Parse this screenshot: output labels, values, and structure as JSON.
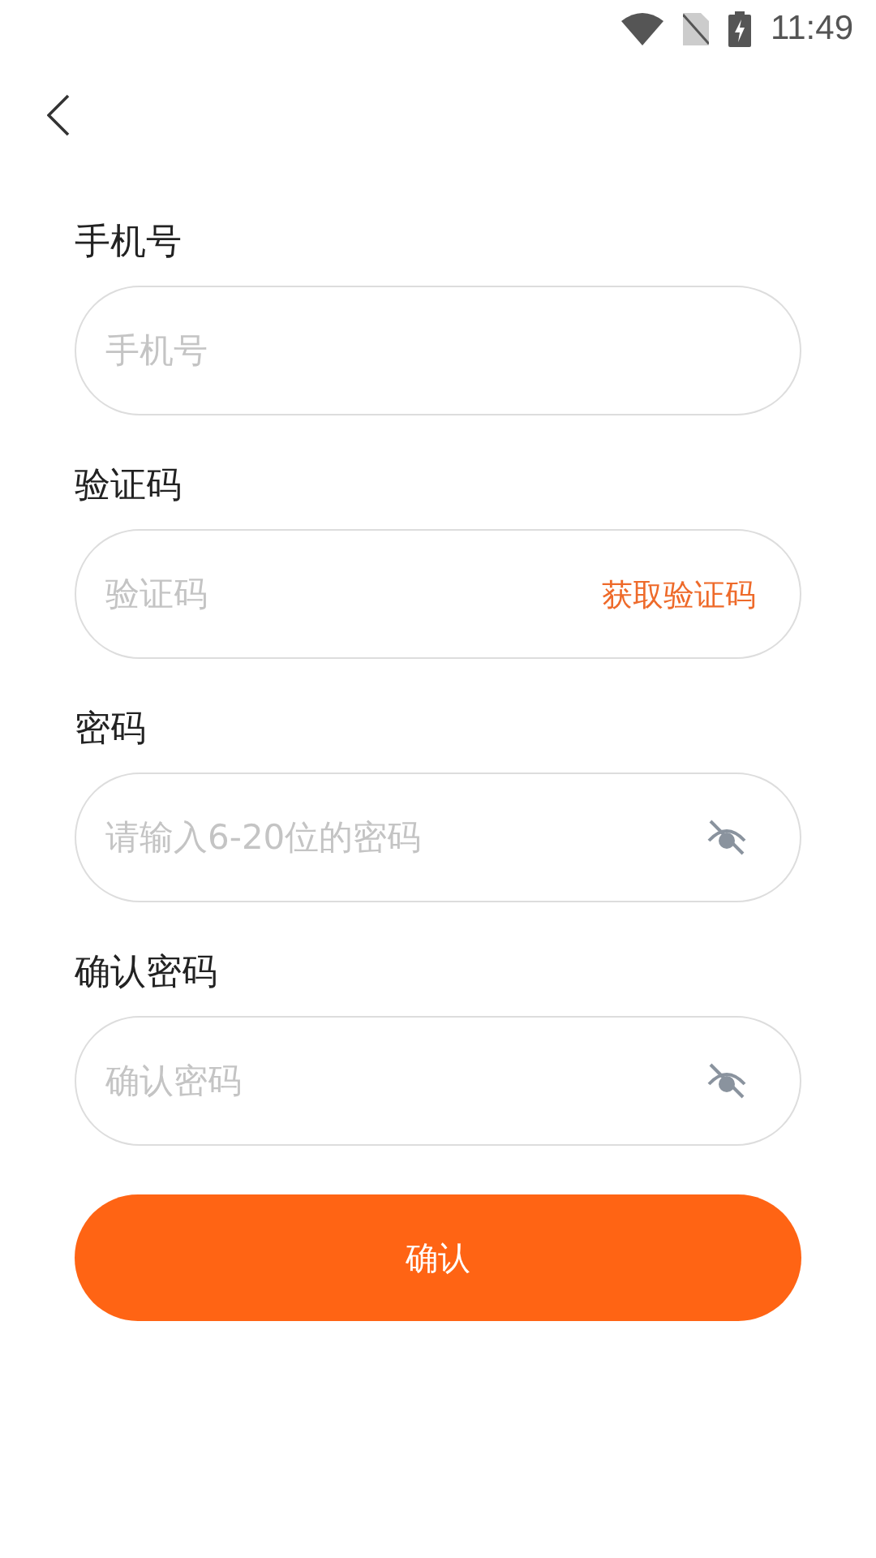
{
  "status_bar": {
    "time": "11:49"
  },
  "fields": [
    {
      "kind": "text",
      "label": "手机号",
      "placeholder": "手机号"
    },
    {
      "kind": "code",
      "label": "验证码",
      "placeholder": "验证码",
      "action": "获取验证码"
    },
    {
      "kind": "password",
      "label": "密码",
      "placeholder": "请输入6-20位的密码",
      "masked": true
    },
    {
      "kind": "password",
      "label": "确认密码",
      "placeholder": "确认密码",
      "masked": true
    }
  ],
  "submit_button": "确认"
}
